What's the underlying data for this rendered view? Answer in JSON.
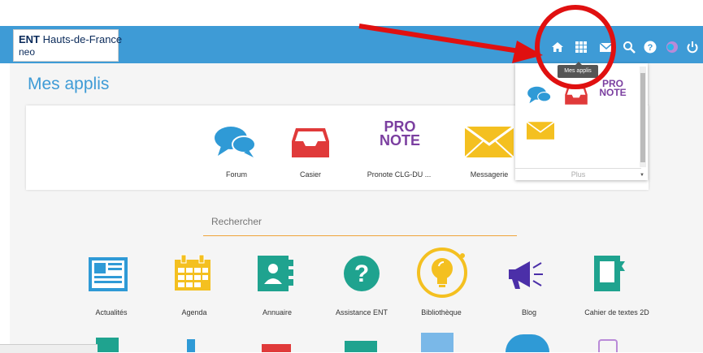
{
  "header": {
    "logo_brand": "ENT",
    "logo_region": "Hauts-de-France",
    "logo_sub": "neo",
    "nav_icons": [
      "home-icon",
      "apps-grid-icon",
      "mail-icon",
      "search-icon",
      "help-icon",
      "avatar-icon",
      "power-icon"
    ]
  },
  "page": {
    "title": "Mes applis"
  },
  "favorites": [
    {
      "label": "Forum",
      "icon": "forum-icon"
    },
    {
      "label": "Casier",
      "icon": "casier-icon"
    },
    {
      "label": "Pronote CLG-DU ...",
      "icon": "pronote-icon"
    },
    {
      "label": "Messagerie",
      "icon": "messagerie-icon"
    }
  ],
  "pronote_logo": {
    "line1": "PRO",
    "line2": "NOTE"
  },
  "search": {
    "placeholder": "Rechercher"
  },
  "apps": [
    {
      "label": "Actualités",
      "icon": "newspaper-icon"
    },
    {
      "label": "Agenda",
      "icon": "calendar-icon"
    },
    {
      "label": "Annuaire",
      "icon": "contact-book-icon"
    },
    {
      "label": "Assistance ENT",
      "icon": "question-icon"
    },
    {
      "label": "Bibliothèque",
      "icon": "lightbulb-icon"
    },
    {
      "label": "Blog",
      "icon": "megaphone-icon"
    },
    {
      "label": "Cahier de textes 2D",
      "icon": "notebook-icon"
    }
  ],
  "dropdown": {
    "tooltip": "Mes applis",
    "more_label": "Plus"
  },
  "colors": {
    "topbar": "#3e9bd6",
    "accent_orange": "#f0a43a",
    "annotation_red": "#e01010"
  }
}
